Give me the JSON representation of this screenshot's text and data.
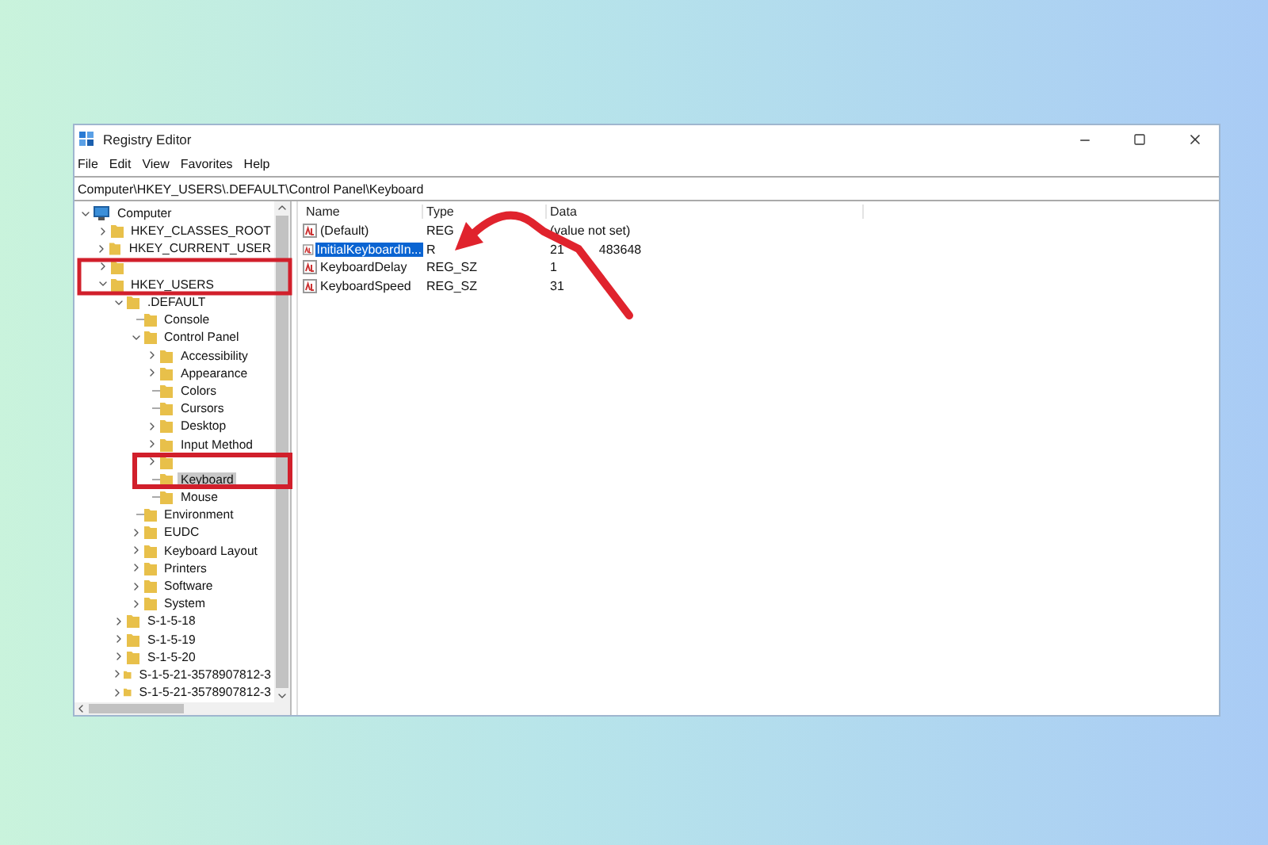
{
  "window": {
    "title": "Registry Editor"
  },
  "menu": [
    "File",
    "Edit",
    "View",
    "Favorites",
    "Help"
  ],
  "address": "Computer\\HKEY_USERS\\.DEFAULT\\Control Panel\\Keyboard",
  "tree": [
    {
      "label": "Computer",
      "kind": "computer",
      "expanded": true,
      "selected": false,
      "children": [
        {
          "label": "HKEY_CLASSES_ROOT",
          "kind": "folder",
          "expanded": false,
          "selected": false
        },
        {
          "label": "HKEY_CURRENT_USER",
          "kind": "folder",
          "expanded": false,
          "selected": false
        },
        {
          "kind": "folder",
          "expanded": false,
          "selected": false
        },
        {
          "label": "HKEY_USERS",
          "kind": "folder",
          "expanded": true,
          "selected": false,
          "children": [
            {
              "label": ".DEFAULT",
              "kind": "folder",
              "expanded": true,
              "selected": false,
              "children": [
                {
                  "label": "Console",
                  "kind": "folder",
                  "selected": false
                },
                {
                  "label": "Control Panel",
                  "kind": "folder",
                  "expanded": true,
                  "selected": false,
                  "children": [
                    {
                      "label": "Accessibility",
                      "kind": "folder",
                      "expanded": false,
                      "selected": false
                    },
                    {
                      "label": "Appearance",
                      "kind": "folder",
                      "expanded": false,
                      "selected": false
                    },
                    {
                      "label": "Colors",
                      "kind": "folder",
                      "selected": false
                    },
                    {
                      "label": "Cursors",
                      "kind": "folder",
                      "selected": false
                    },
                    {
                      "label": "Desktop",
                      "kind": "folder",
                      "expanded": false,
                      "selected": false
                    },
                    {
                      "label": "Input Method",
                      "kind": "folder",
                      "expanded": false,
                      "selected": false
                    },
                    {
                      "kind": "folder",
                      "expanded": false,
                      "selected": false
                    },
                    {
                      "label": "Keyboard",
                      "kind": "folder",
                      "selected": true
                    },
                    {
                      "label": "Mouse",
                      "kind": "folder",
                      "selected": false
                    }
                  ]
                },
                {
                  "label": "Environment",
                  "kind": "folder",
                  "selected": false
                },
                {
                  "label": "EUDC",
                  "kind": "folder",
                  "expanded": false,
                  "selected": false
                },
                {
                  "label": "Keyboard Layout",
                  "kind": "folder",
                  "expanded": false,
                  "selected": false
                },
                {
                  "label": "Printers",
                  "kind": "folder",
                  "expanded": false,
                  "selected": false
                },
                {
                  "label": "Software",
                  "kind": "folder",
                  "expanded": false,
                  "selected": false
                },
                {
                  "label": "System",
                  "kind": "folder",
                  "expanded": false,
                  "selected": false
                }
              ]
            },
            {
              "label": "S-1-5-18",
              "kind": "folder",
              "expanded": false,
              "selected": false
            },
            {
              "label": "S-1-5-19",
              "kind": "folder",
              "expanded": false,
              "selected": false
            },
            {
              "label": "S-1-5-20",
              "kind": "folder",
              "expanded": false,
              "selected": false
            },
            {
              "label": "S-1-5-21-3578907812-3",
              "kind": "folder",
              "expanded": false,
              "selected": false
            },
            {
              "label": "S-1-5-21-3578907812-3",
              "kind": "folder",
              "expanded": false,
              "selected": false
            }
          ]
        }
      ]
    }
  ],
  "columns": [
    "Name",
    "Type",
    "Data"
  ],
  "values": [
    {
      "name": "(Default)",
      "type": "REG",
      "data": "(value not set)",
      "selected": false
    },
    {
      "name": "InitialKeyboardIn...",
      "type": "R",
      "data": "21",
      "data_tail": "483648",
      "selected": true
    },
    {
      "name": "KeyboardDelay",
      "type": "REG_SZ",
      "data": "1",
      "selected": false
    },
    {
      "name": "KeyboardSpeed",
      "type": "REG_SZ",
      "data": "31",
      "selected": false
    }
  ]
}
